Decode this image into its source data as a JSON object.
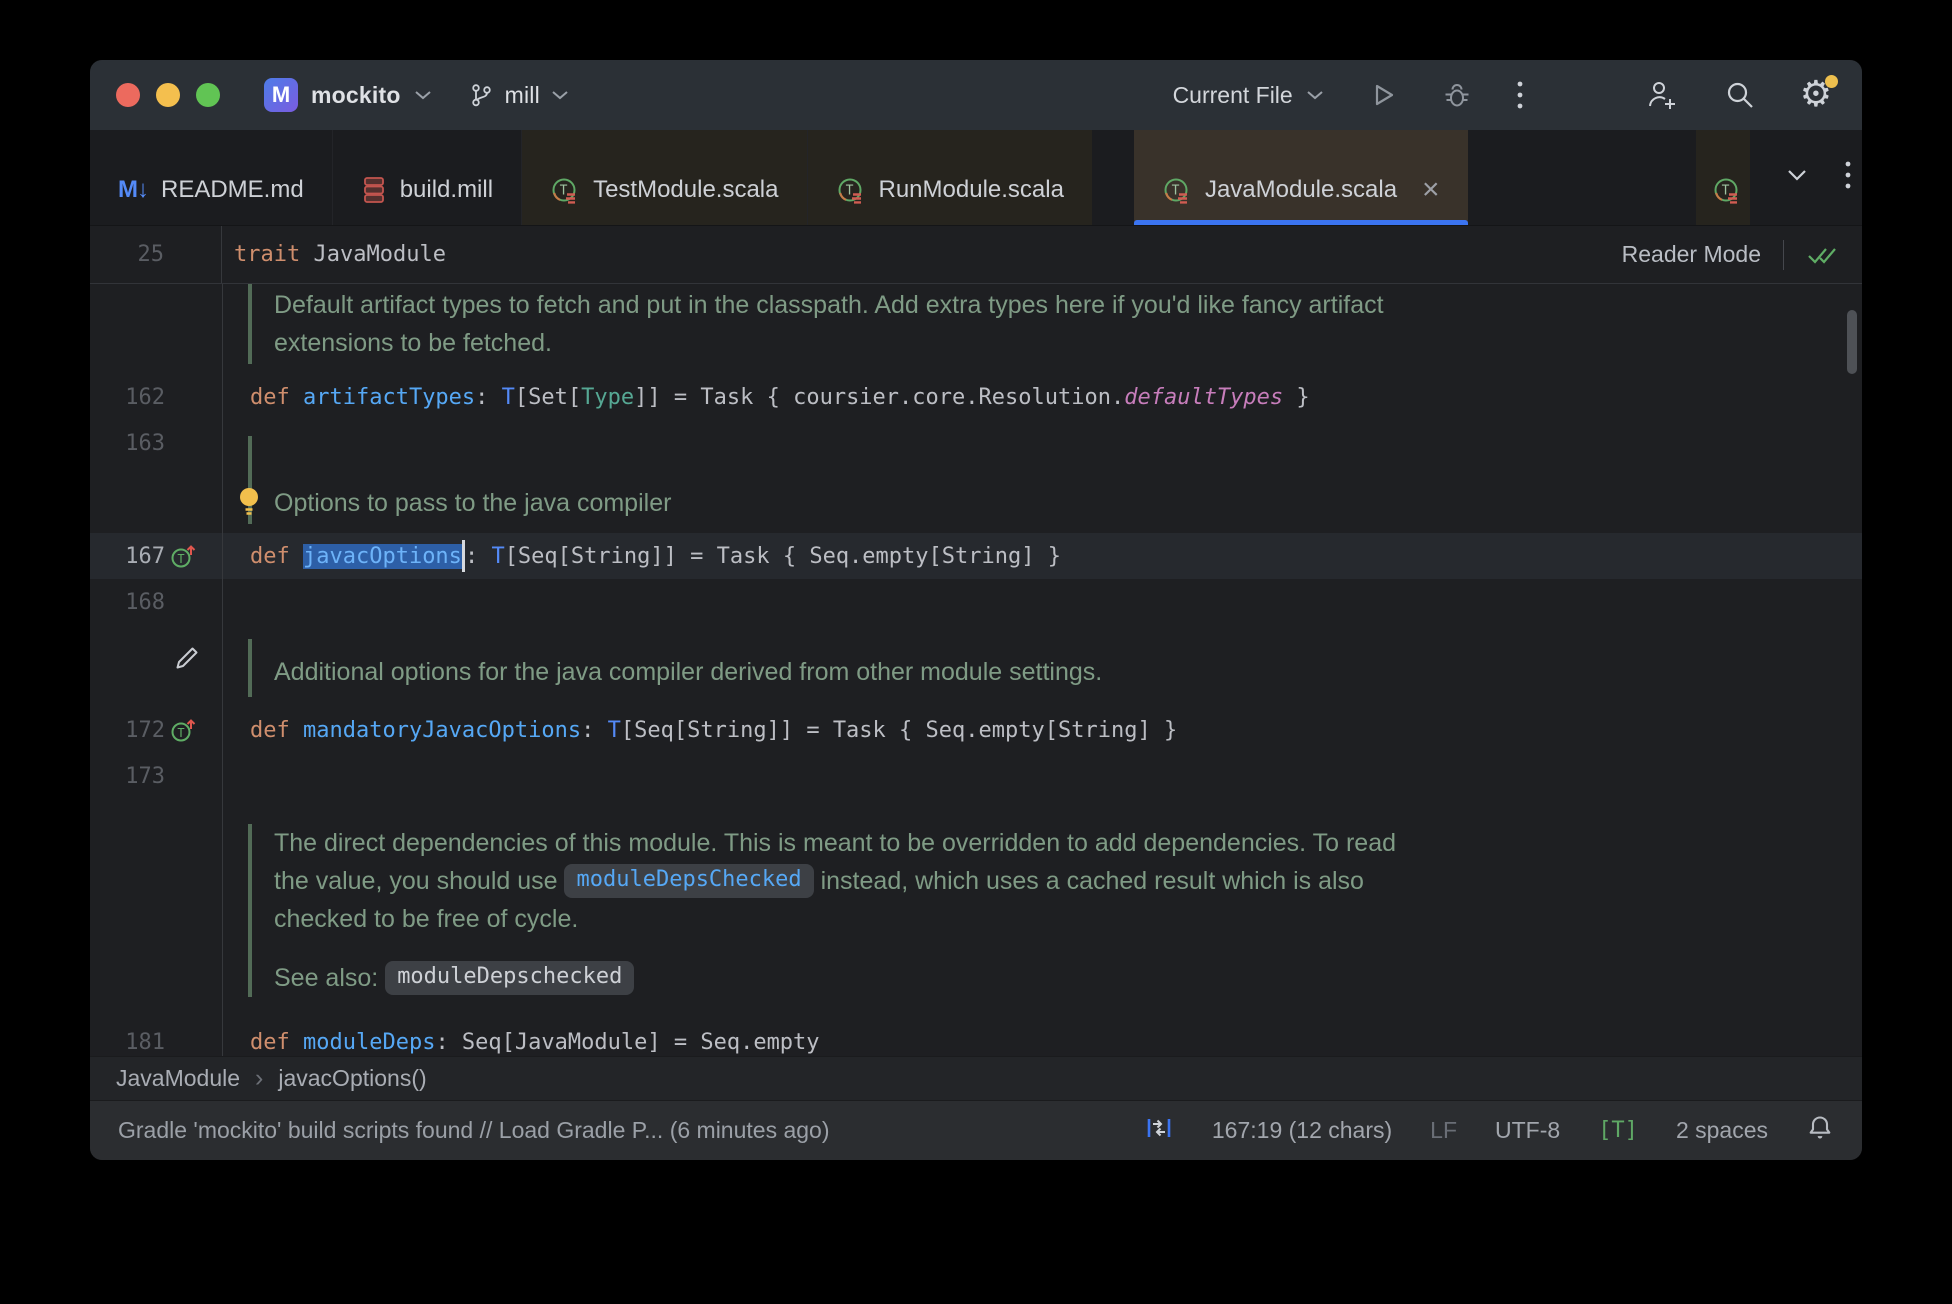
{
  "titlebar": {
    "project_initial": "M",
    "project_name": "mockito",
    "branch_name": "mill",
    "run_config": "Current File"
  },
  "icons": {
    "markdown_glyph": "M↓",
    "gear_glyph": "⚙"
  },
  "tabs": [
    {
      "label": "README.md"
    },
    {
      "label": "build.mill"
    },
    {
      "label": "TestModule.scala"
    },
    {
      "label": "RunModule.scala"
    },
    {
      "label": "JavaModule.scala",
      "close": "×"
    }
  ],
  "sticky": {
    "line_number": "25",
    "keyword": "trait ",
    "name": "JavaModule",
    "reader_mode": "Reader Mode"
  },
  "editor": {
    "rows": [
      {
        "kind": "doc",
        "pt": 2,
        "pb": 2,
        "lines": [
          [
            {
              "t": "Default artifact types to fetch and put in the classpath. Add extra types here if you'd like fancy artifact"
            }
          ],
          [
            {
              "t": "extensions to be fetched."
            }
          ]
        ]
      },
      {
        "kind": "spacer",
        "h": 10
      },
      {
        "kind": "code",
        "num": "162",
        "tokens": [
          {
            "t": "def ",
            "c": "kw"
          },
          {
            "t": "artifactTypes",
            "c": "fn"
          },
          {
            "t": ": ",
            "c": "pl"
          },
          {
            "t": "T",
            "c": "ty"
          },
          {
            "t": "[Set[",
            "c": "pl"
          },
          {
            "t": "Type",
            "c": "tyg"
          },
          {
            "t": "]] = Task { coursier.core.Resolution.",
            "c": "pl"
          },
          {
            "t": "defaultTypes",
            "c": "em"
          },
          {
            "t": " }",
            "c": "pl"
          }
        ]
      },
      {
        "kind": "code",
        "num": "163",
        "tokens": []
      },
      {
        "kind": "spacer",
        "h": 16
      },
      {
        "kind": "doc",
        "pt": 2,
        "pb": 2,
        "bulb": true,
        "lines": [
          [
            {
              "t": "Options to pass to the java compiler"
            }
          ]
        ]
      },
      {
        "kind": "spacer",
        "h": 9
      },
      {
        "kind": "code",
        "num": "167",
        "icon": "override",
        "current": true,
        "tokens": [
          {
            "t": "def ",
            "c": "kw"
          },
          {
            "t": "javacOptions",
            "c": "fn sel"
          },
          {
            "c": "caret"
          },
          {
            "t": ": ",
            "c": "pl"
          },
          {
            "t": "T",
            "c": "ty"
          },
          {
            "t": "[Seq[String]] = Task { Seq.empty[String] }",
            "c": "pl"
          }
        ]
      },
      {
        "kind": "code",
        "num": "168",
        "tokens": []
      },
      {
        "kind": "spacer",
        "h": 14
      },
      {
        "kind": "doc",
        "pt": 14,
        "pb": 6,
        "pencil": true,
        "lines": [
          [
            {
              "t": "Additional options for the java compiler derived from other module settings."
            }
          ]
        ]
      },
      {
        "kind": "spacer",
        "h": 10
      },
      {
        "kind": "code",
        "num": "172",
        "icon": "override",
        "tokens": [
          {
            "t": "def ",
            "c": "kw"
          },
          {
            "t": "mandatoryJavacOptions",
            "c": "fn"
          },
          {
            "t": ": ",
            "c": "pl"
          },
          {
            "t": "T",
            "c": "ty"
          },
          {
            "t": "[Seq[String]] = Task { Seq.empty[String] }",
            "c": "pl"
          }
        ]
      },
      {
        "kind": "code",
        "num": "173",
        "tokens": []
      },
      {
        "kind": "spacer",
        "h": 25
      },
      {
        "kind": "doc",
        "pt": 0,
        "pb": 0,
        "lines": [
          [
            {
              "t": "The direct dependencies of this module. This is meant to be overridden to add dependencies. To read"
            }
          ],
          [
            {
              "t": "the value, you should use "
            },
            {
              "t": "moduleDepsChecked",
              "c": "chipb"
            },
            {
              "t": " instead, which uses a cached result which is also"
            }
          ],
          [
            {
              "t": "checked to be free of cycle."
            }
          ],
          [
            {
              "t": "See also: ",
              "gap": true
            },
            {
              "t": "moduleDepschecked",
              "c": "chipw"
            }
          ]
        ]
      },
      {
        "kind": "spacer",
        "h": 22
      },
      {
        "kind": "code",
        "num": "181",
        "tokens": [
          {
            "t": "def ",
            "c": "kw"
          },
          {
            "t": "moduleDeps",
            "c": "fn"
          },
          {
            "t": ": Seq[JavaModule] = Seq.empty",
            "c": "pl"
          }
        ]
      }
    ]
  },
  "breadcrumbs": {
    "items": [
      "JavaModule",
      "javacOptions()"
    ],
    "separator": "›"
  },
  "statusbar": {
    "message": "Gradle 'mockito' build scripts found // Load Gradle P... (6 minutes ago)",
    "caret_position": "167:19 (12 chars)",
    "line_separator": "LF",
    "encoding": "UTF-8",
    "file_type": "[T]",
    "indent": "2 spaces"
  }
}
